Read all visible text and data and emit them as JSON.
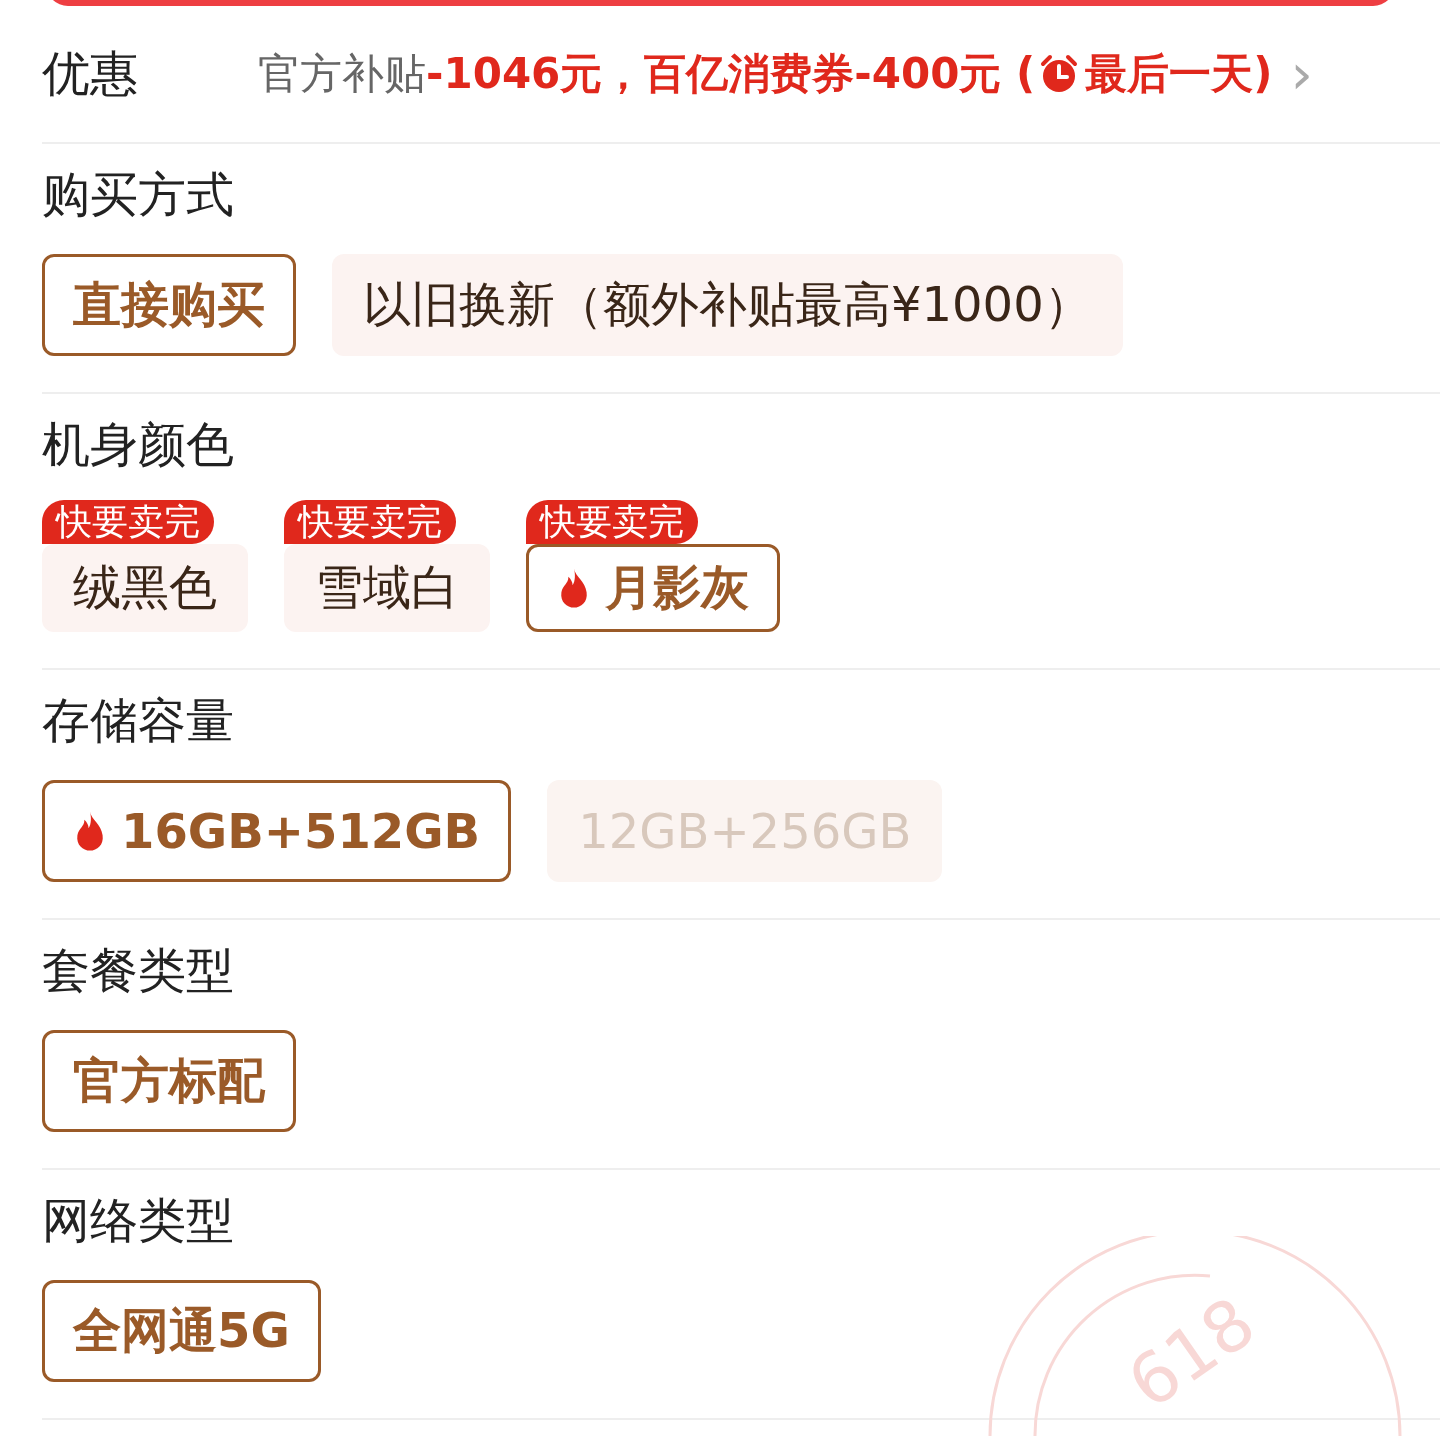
{
  "promo": {
    "label": "优惠",
    "subsidy": "官方补贴",
    "coupon": "-1046元，百亿消费券-400元 (",
    "deadline": "最后一天)",
    "chevron": "›"
  },
  "sections": [
    {
      "title": "购买方式",
      "options": [
        {
          "label": "直接购买",
          "selected": true,
          "disabled": false,
          "hot": false
        },
        {
          "label": "以旧换新（额外补贴最高¥1000）",
          "selected": false,
          "disabled": false,
          "hot": false
        }
      ]
    },
    {
      "title": "机身颜色",
      "options": [
        {
          "label": "绒黑色",
          "selected": false,
          "disabled": false,
          "hot": false,
          "badge": "快要卖完"
        },
        {
          "label": "雪域白",
          "selected": false,
          "disabled": false,
          "hot": false,
          "badge": "快要卖完"
        },
        {
          "label": "月影灰",
          "selected": true,
          "disabled": false,
          "hot": true,
          "badge": "快要卖完"
        }
      ]
    },
    {
      "title": "存储容量",
      "options": [
        {
          "label": "16GB+512GB",
          "selected": true,
          "disabled": false,
          "hot": true
        },
        {
          "label": "12GB+256GB",
          "selected": false,
          "disabled": true,
          "hot": false
        }
      ]
    },
    {
      "title": "套餐类型",
      "options": [
        {
          "label": "官方标配",
          "selected": true,
          "disabled": false,
          "hot": false
        }
      ]
    },
    {
      "title": "网络类型",
      "options": [
        {
          "label": "全网通5G",
          "selected": true,
          "disabled": false,
          "hot": false
        }
      ]
    }
  ],
  "stamp": {
    "text": "618"
  }
}
